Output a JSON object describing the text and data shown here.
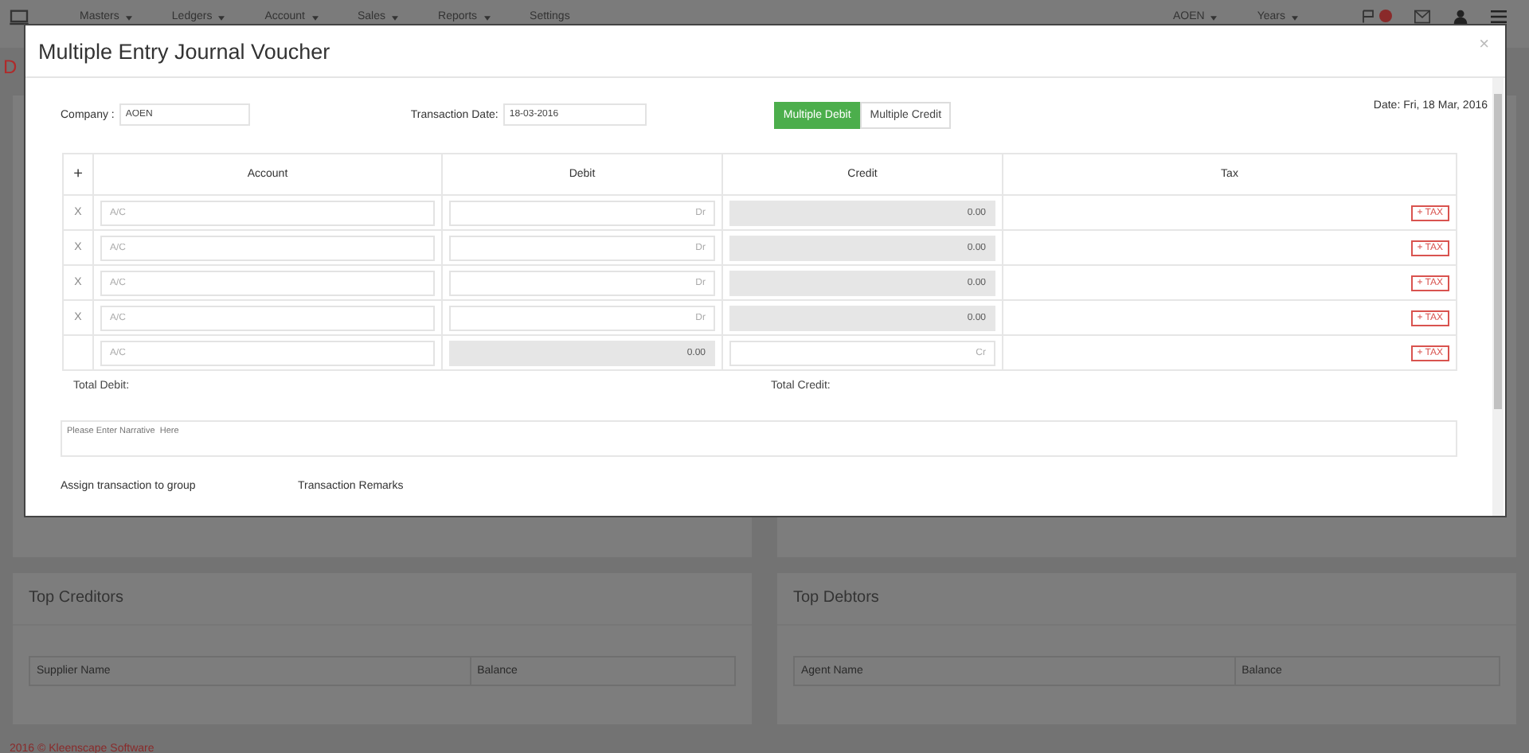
{
  "navbar": {
    "menu": [
      {
        "label": "Masters",
        "dropdown": true
      },
      {
        "label": "Ledgers",
        "dropdown": true
      },
      {
        "label": "Account",
        "dropdown": true
      },
      {
        "label": "Sales",
        "dropdown": true
      },
      {
        "label": "Reports",
        "dropdown": true
      },
      {
        "label": "Settings",
        "dropdown": false
      }
    ],
    "right_menu": [
      {
        "label": "AOEN",
        "dropdown": true
      },
      {
        "label": "Years",
        "dropdown": true
      }
    ]
  },
  "page": {
    "title": "D",
    "panels": [
      {
        "title": "Top Creditors",
        "columns": [
          "Supplier Name",
          "Balance"
        ]
      },
      {
        "title": "Top Debtors",
        "columns": [
          "Agent Name",
          "Balance"
        ]
      }
    ],
    "footer": "2016 © Kleenscape Software"
  },
  "modal": {
    "title": "Multiple Entry Journal Voucher",
    "close": "×",
    "company": {
      "label": "Company :",
      "value": "AOEN"
    },
    "transaction_date": {
      "label": "Transaction Date:",
      "value": "18-03-2016"
    },
    "mode_buttons": [
      {
        "label": "Multiple Debit",
        "selected": true
      },
      {
        "label": "Multiple Credit",
        "selected": false
      }
    ],
    "date": "Date: Fri, 18 Mar, 2016",
    "table": {
      "add": "+",
      "columns": [
        "Account",
        "Debit",
        "Credit",
        "Tax"
      ],
      "rows": [
        {
          "remove": "X",
          "account": {
            "placeholder": "A/C"
          },
          "debit": {
            "placeholder": "Dr",
            "disabled": false
          },
          "credit": {
            "value": "0.00",
            "disabled": true
          },
          "tax": "+ TAX"
        },
        {
          "remove": "X",
          "account": {
            "placeholder": "A/C"
          },
          "debit": {
            "placeholder": "Dr",
            "disabled": false
          },
          "credit": {
            "value": "0.00",
            "disabled": true
          },
          "tax": "+ TAX"
        },
        {
          "remove": "X",
          "account": {
            "placeholder": "A/C"
          },
          "debit": {
            "placeholder": "Dr",
            "disabled": false
          },
          "credit": {
            "value": "0.00",
            "disabled": true
          },
          "tax": "+ TAX"
        },
        {
          "remove": "X",
          "account": {
            "placeholder": "A/C"
          },
          "debit": {
            "placeholder": "Dr",
            "disabled": false
          },
          "credit": {
            "value": "0.00",
            "disabled": true
          },
          "tax": "+ TAX"
        },
        {
          "account": {
            "placeholder": "A/C"
          },
          "debit": {
            "value": "0.00",
            "disabled": true
          },
          "credit": {
            "placeholder": "Cr",
            "disabled": false
          },
          "tax": "+ TAX"
        }
      ]
    },
    "total_debit": "Total Debit:",
    "total_credit": "Total Credit:",
    "narrative": {
      "placeholder": "Please Enter Narrative  Here"
    },
    "assign_label": "Assign transaction to group",
    "remarks_label": "Transaction Remarks"
  }
}
